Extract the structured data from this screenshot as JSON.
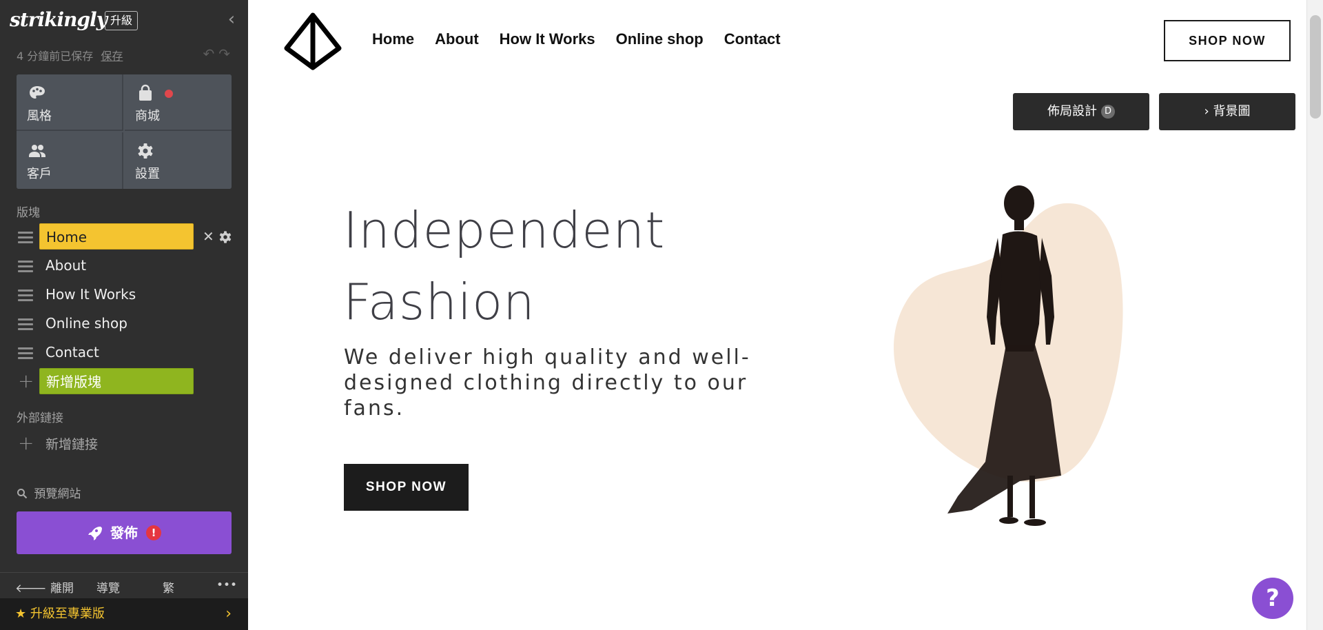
{
  "sidebar": {
    "brand": "strikingly",
    "upgrade_badge": "升級",
    "save_status": "4 分鐘前已保存",
    "save_link": "保存",
    "tiles": [
      {
        "label": "風格",
        "icon": "palette-icon"
      },
      {
        "label": "商城",
        "icon": "shopping-bag-icon"
      },
      {
        "label": "客戶",
        "icon": "people-icon"
      },
      {
        "label": "設置",
        "icon": "gear-icon"
      }
    ],
    "blocks_heading": "版塊",
    "blocks": [
      "Home",
      "About",
      "How It Works",
      "Online shop",
      "Contact"
    ],
    "add_block": "新增版塊",
    "external_links_heading": "外部鏈接",
    "add_link": "新增鏈接",
    "preview": "預覽網站",
    "publish": "發佈",
    "bottom": {
      "exit": "離開",
      "guide": "導覽",
      "lang": "繁",
      "more": "•••"
    },
    "upgrade_pro": "升級至專業版"
  },
  "site": {
    "nav": [
      "Home",
      "About",
      "How It Works",
      "Online shop",
      "Contact"
    ],
    "shop_now_top": "SHOP NOW",
    "layout_button": "佈局設計",
    "layout_badge": "D",
    "background_button": "› 背景圖",
    "hero_title_line1": "Independent",
    "hero_title_line2": "Fashion",
    "hero_subtitle": "We deliver high quality and well-designed clothing directly to our fans.",
    "hero_button": "SHOP NOW",
    "help": "?"
  },
  "colors": {
    "sidebar_bg": "#2f2f2f",
    "active_block": "#f4c430",
    "add_block": "#8fb51f",
    "publish": "#8a4fd3",
    "blob": "#f6e6d6"
  }
}
